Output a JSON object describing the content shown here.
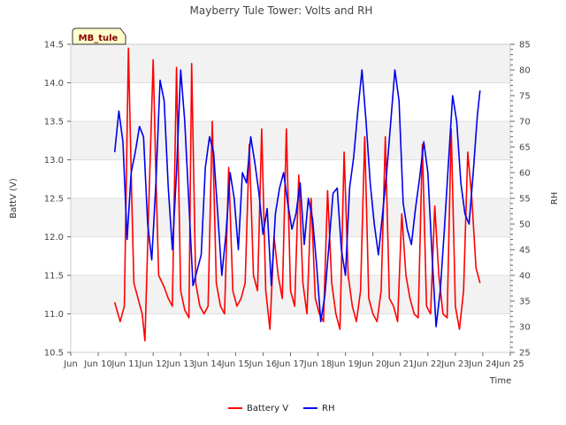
{
  "chart_data": {
    "type": "line",
    "title": "Mayberry Tule Tower: Volts and RH",
    "site_label": "MB_tule",
    "xlabel": "Time",
    "ylabel_left": "BattV (V)",
    "ylabel_right": "RH",
    "x_tick_labels": [
      "Jun 10",
      "Jun 11",
      "Jun 12",
      "Jun 13",
      "Jun 14",
      "Jun 15",
      "Jun 16",
      "Jun 17",
      "Jun 18",
      "Jun 19",
      "Jun 20",
      "Jun 21",
      "Jun 22",
      "Jun 23",
      "Jun 24",
      "Jun 25"
    ],
    "x_range": [
      "Jun 10",
      "Jun 25"
    ],
    "y_left_ticks": [
      "10.5",
      "11.0",
      "11.5",
      "12.0",
      "12.5",
      "13.0",
      "13.5",
      "14.0",
      "14.5"
    ],
    "y_left_range": [
      10.5,
      14.5
    ],
    "y_right_ticks": [
      "25",
      "30",
      "35",
      "40",
      "45",
      "50",
      "55",
      "60",
      "65",
      "70",
      "75",
      "80",
      "85"
    ],
    "y_right_range": [
      25,
      85
    ],
    "background_bands": true,
    "grid": true,
    "legend_position": "bottom",
    "series": [
      {
        "name": "Battery V",
        "axis": "left",
        "color": "#ff0000",
        "x_day": [
          10.6,
          10.72,
          10.8,
          10.95,
          11.1,
          11.22,
          11.3,
          11.45,
          11.6,
          11.7,
          11.85,
          12.0,
          12.1,
          12.2,
          12.4,
          12.55,
          12.7,
          12.85,
          13.0,
          13.15,
          13.3,
          13.4,
          13.55,
          13.7,
          13.85,
          14.0,
          14.15,
          14.3,
          14.45,
          14.6,
          14.75,
          14.9,
          15.05,
          15.2,
          15.35,
          15.5,
          15.65,
          15.8,
          15.95,
          16.1,
          16.25,
          16.4,
          16.55,
          16.7,
          16.85,
          17.0,
          17.15,
          17.3,
          17.45,
          17.6,
          17.75,
          17.9,
          18.05,
          18.2,
          18.35,
          18.5,
          18.65,
          18.8,
          18.95,
          19.1,
          19.25,
          19.4,
          19.55,
          19.7,
          19.85,
          20.0,
          20.15,
          20.3,
          20.45,
          20.6,
          20.75,
          20.9,
          21.05,
          21.2,
          21.35,
          21.5,
          21.65,
          21.8,
          21.95,
          22.1,
          22.25,
          22.4,
          22.55,
          22.7,
          22.85,
          23.0,
          23.15,
          23.3,
          23.45,
          23.6,
          23.75,
          23.9
        ],
        "y": [
          11.15,
          11.0,
          10.9,
          11.1,
          14.45,
          12.5,
          11.4,
          11.2,
          11.0,
          10.65,
          12.5,
          14.3,
          12.8,
          11.5,
          11.35,
          11.2,
          11.1,
          14.2,
          11.3,
          11.05,
          10.95,
          14.25,
          11.4,
          11.1,
          11.0,
          11.1,
          13.5,
          11.4,
          11.1,
          11.0,
          12.9,
          11.3,
          11.1,
          11.2,
          11.4,
          13.2,
          11.5,
          11.3,
          13.4,
          11.3,
          10.8,
          12.0,
          11.5,
          11.2,
          13.4,
          11.3,
          11.1,
          12.8,
          11.4,
          11.0,
          12.5,
          11.2,
          11.0,
          10.9,
          12.6,
          11.4,
          11.0,
          10.8,
          13.1,
          11.5,
          11.1,
          10.9,
          11.3,
          13.3,
          11.2,
          11.0,
          10.9,
          11.3,
          13.3,
          11.2,
          11.1,
          10.9,
          12.3,
          11.5,
          11.2,
          11.0,
          10.95,
          13.2,
          11.1,
          11.0,
          12.4,
          11.5,
          11.0,
          10.95,
          13.4,
          11.1,
          10.8,
          11.3,
          13.1,
          12.5,
          11.6,
          11.4
        ],
        "points_note": null
      },
      {
        "name": "RH",
        "axis": "right",
        "color": "#0000ee",
        "x_day": [
          10.6,
          10.75,
          10.9,
          11.05,
          11.2,
          11.35,
          11.5,
          11.65,
          11.8,
          11.95,
          12.1,
          12.25,
          12.4,
          12.55,
          12.7,
          12.85,
          13.0,
          13.15,
          13.3,
          13.45,
          13.6,
          13.75,
          13.9,
          14.05,
          14.2,
          14.35,
          14.5,
          14.65,
          14.8,
          14.95,
          15.1,
          15.25,
          15.4,
          15.55,
          15.7,
          15.85,
          16.0,
          16.15,
          16.3,
          16.45,
          16.6,
          16.75,
          16.9,
          17.05,
          17.2,
          17.35,
          17.5,
          17.65,
          17.8,
          17.95,
          18.1,
          18.25,
          18.4,
          18.55,
          18.7,
          18.85,
          19.0,
          19.15,
          19.3,
          19.45,
          19.6,
          19.75,
          19.9,
          20.05,
          20.2,
          20.35,
          20.5,
          20.65,
          20.8,
          20.95,
          21.1,
          21.25,
          21.4,
          21.55,
          21.7,
          21.85,
          22.0,
          22.15,
          22.3,
          22.45,
          22.6,
          22.75,
          22.9,
          23.05,
          23.2,
          23.35,
          23.5,
          23.65,
          23.8,
          23.9
        ],
        "y": [
          64,
          72,
          66,
          47,
          60,
          64,
          69,
          67,
          50,
          43,
          58,
          78,
          74,
          57,
          45,
          60,
          80,
          70,
          54,
          38,
          41,
          44,
          61,
          67,
          64,
          52,
          40,
          48,
          60,
          55,
          45,
          60,
          58,
          67,
          62,
          56,
          48,
          53,
          38,
          52,
          57,
          60,
          54,
          49,
          52,
          58,
          46,
          55,
          51,
          42,
          31,
          36,
          46,
          56,
          57,
          45,
          40,
          57,
          63,
          72,
          80,
          70,
          58,
          50,
          44,
          52,
          60,
          70,
          80,
          74,
          54,
          49,
          46,
          53,
          59,
          66,
          60,
          44,
          30,
          37,
          49,
          62,
          75,
          70,
          58,
          52,
          50,
          60,
          71,
          76
        ],
        "points_note": null
      }
    ]
  }
}
